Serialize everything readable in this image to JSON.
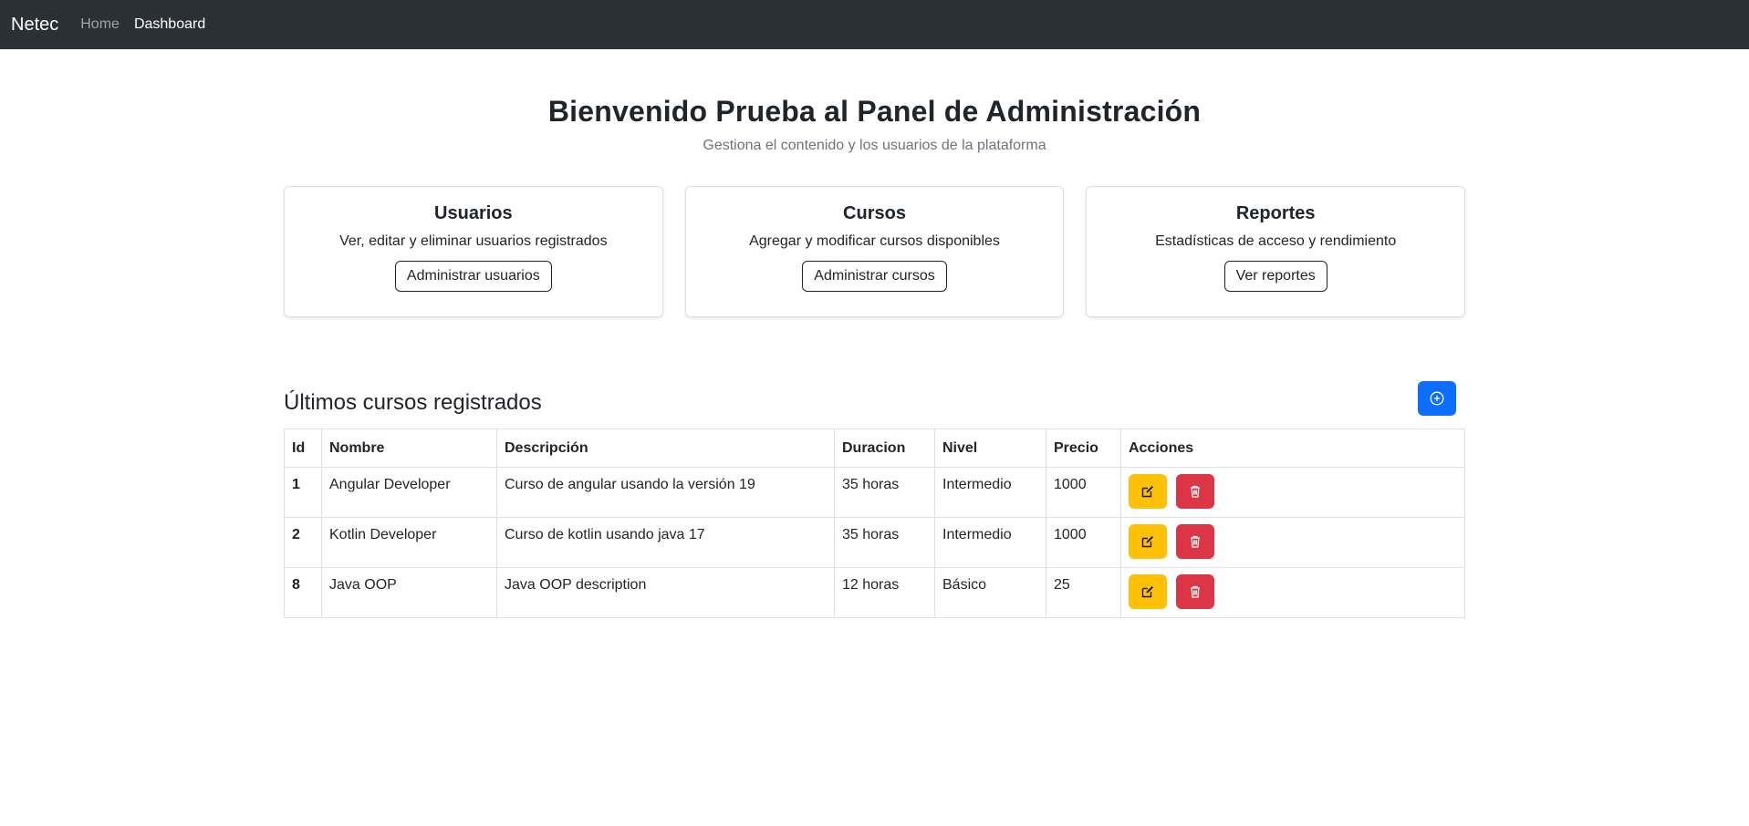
{
  "nav": {
    "brand": "Netec",
    "links": [
      {
        "label": "Home"
      },
      {
        "label": "Dashboard"
      }
    ]
  },
  "header": {
    "title": "Bienvenido Prueba al Panel de Administración",
    "subtitle": "Gestiona el contenido y los usuarios de la plataforma"
  },
  "cards": [
    {
      "title": "Usuarios",
      "description": "Ver, editar y eliminar usuarios registrados",
      "button": "Administrar usuarios"
    },
    {
      "title": "Cursos",
      "description": "Agregar y modificar cursos disponibles",
      "button": "Administrar cursos"
    },
    {
      "title": "Reportes",
      "description": "Estadísticas de acceso y rendimiento",
      "button": "Ver reportes"
    }
  ],
  "courses": {
    "title": "Últimos cursos registrados",
    "add_icon": "plus-circle-icon",
    "columns": [
      "Id",
      "Nombre",
      "Descripción",
      "Duracion",
      "Nivel",
      "Precio",
      "Acciones"
    ],
    "rows": [
      {
        "id": "1",
        "nombre": "Angular Developer",
        "descripcion": "Curso de angular usando la versión 19",
        "duracion": "35 horas",
        "nivel": "Intermedio",
        "precio": "1000"
      },
      {
        "id": "2",
        "nombre": "Kotlin Developer",
        "descripcion": "Curso de kotlin usando java 17",
        "duracion": "35 horas",
        "nivel": "Intermedio",
        "precio": "1000"
      },
      {
        "id": "8",
        "nombre": "Java OOP",
        "descripcion": "Java OOP description",
        "duracion": "12 horas",
        "nivel": "Básico",
        "precio": "25"
      }
    ],
    "edit_icon": "pencil-square-icon",
    "delete_icon": "trash-icon"
  },
  "colors": {
    "navbar": "#2b3035",
    "primary": "#0d6efd",
    "warning": "#ffc107",
    "danger": "#dc3545"
  }
}
